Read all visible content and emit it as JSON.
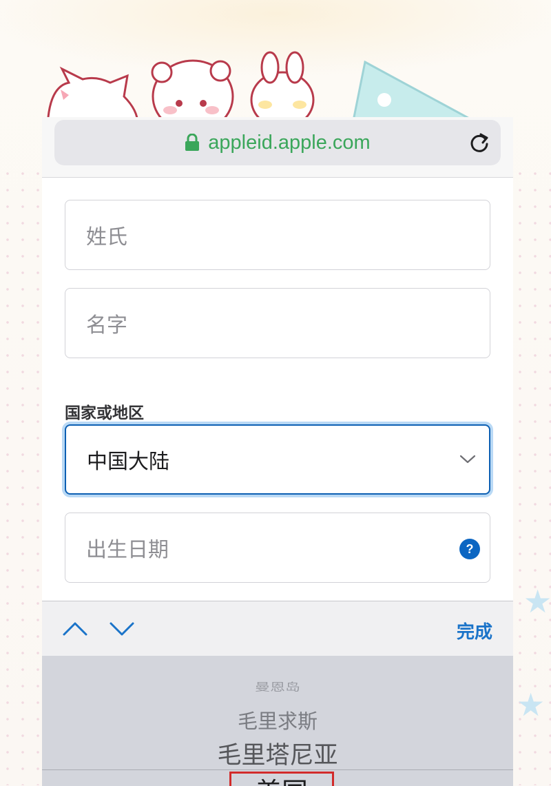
{
  "browser": {
    "url": "appleid.apple.com",
    "url_color": "#3aa65a",
    "lock_icon": "lock-icon",
    "reload_icon": "reload-icon"
  },
  "form": {
    "last_name_placeholder": "姓氏",
    "first_name_placeholder": "名字",
    "country_label": "国家或地区",
    "country_value": "中国大陆",
    "birthdate_placeholder": "出生日期",
    "help_glyph": "?"
  },
  "keyboard_toolbar": {
    "previous_icon": "chevron-up-icon",
    "next_icon": "chevron-down-icon",
    "done_label": "完成",
    "accent": "#1a73c9"
  },
  "picker": {
    "options": [
      "曼恩岛",
      "毛里求斯",
      "毛里塔尼亚",
      "美国"
    ],
    "selected": "美国",
    "highlight_color": "#d22b2b"
  },
  "colors": {
    "focus_border": "#0c5fb3",
    "help_icon": "#0c66c2"
  }
}
